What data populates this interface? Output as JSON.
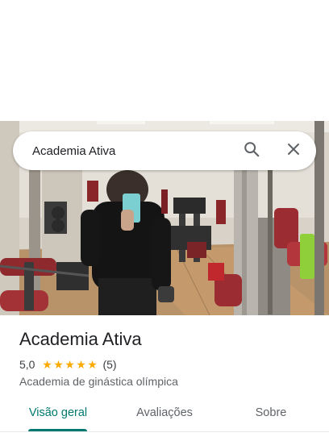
{
  "search": {
    "value": "Academia Ativa"
  },
  "place": {
    "name": "Academia Ativa",
    "rating": "5,0",
    "stars": 5,
    "review_count": "(5)",
    "category": "Academia de ginástica olímpica"
  },
  "tabs": [
    {
      "label": "Visão geral",
      "active": true
    },
    {
      "label": "Avaliações",
      "active": false
    },
    {
      "label": "Sobre",
      "active": false
    }
  ],
  "icons": {
    "search": "search-icon",
    "close": "close-icon",
    "star": "star-icon"
  },
  "colors": {
    "accent": "#01796f",
    "star": "#f9ab00",
    "text_primary": "#202124",
    "text_secondary": "#5f6368"
  }
}
